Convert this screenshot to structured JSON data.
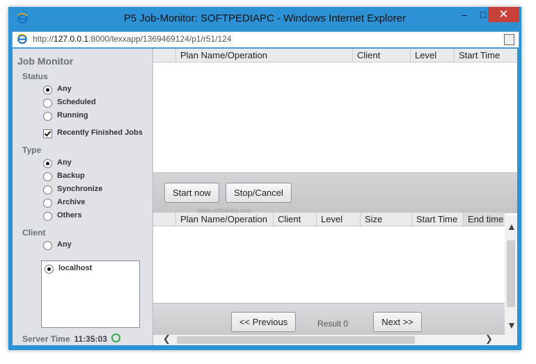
{
  "window": {
    "title": "P5 Job-Monitor: SOFTPEDIAPC - Windows Internet Explorer",
    "minimize": "–",
    "maximize": "□",
    "close": "✕"
  },
  "address": {
    "prefix": "http://",
    "host": "127.0.0.1",
    "rest": ":8000/lexxapp/1369469124/p1/r51/124"
  },
  "sidebar": {
    "title": "Job Monitor",
    "status_label": "Status",
    "status_options": [
      {
        "label": "Any",
        "selected": true
      },
      {
        "label": "Scheduled",
        "selected": false
      },
      {
        "label": "Running",
        "selected": false
      }
    ],
    "recently_finished": {
      "label": "Recently Finished Jobs",
      "checked": true
    },
    "type_label": "Type",
    "type_options": [
      {
        "label": "Any",
        "selected": true
      },
      {
        "label": "Backup",
        "selected": false
      },
      {
        "label": "Synchronize",
        "selected": false
      },
      {
        "label": "Archive",
        "selected": false
      },
      {
        "label": "Others",
        "selected": false
      }
    ],
    "client_label": "Client",
    "client_any": {
      "label": "Any",
      "selected": false
    },
    "client_list": [
      {
        "label": "localhost",
        "selected": true
      }
    ],
    "server_time_label": "Server Time",
    "server_time": "11:35:03"
  },
  "top_table": {
    "columns": [
      "Plan Name/Operation",
      "Client",
      "Level",
      "Start Time"
    ]
  },
  "actions": {
    "start_now": "Start now",
    "stop_cancel": "Stop/Cancel",
    "watermark": "www.softpedia.com"
  },
  "bottom_table": {
    "columns": [
      "Plan Name/Operation",
      "Client",
      "Level",
      "Size",
      "Start Time",
      "End time"
    ]
  },
  "pager": {
    "previous": "<< Previous",
    "result": "Result 0",
    "next": "Next >>"
  },
  "icons": {
    "ie": "ie-logo-icon",
    "clock": "clock-icon",
    "compat": "compatibility-view-icon"
  },
  "colors": {
    "frame": "#2d91d6",
    "close": "#c7413a",
    "sidebar": "#dfe2e6"
  }
}
